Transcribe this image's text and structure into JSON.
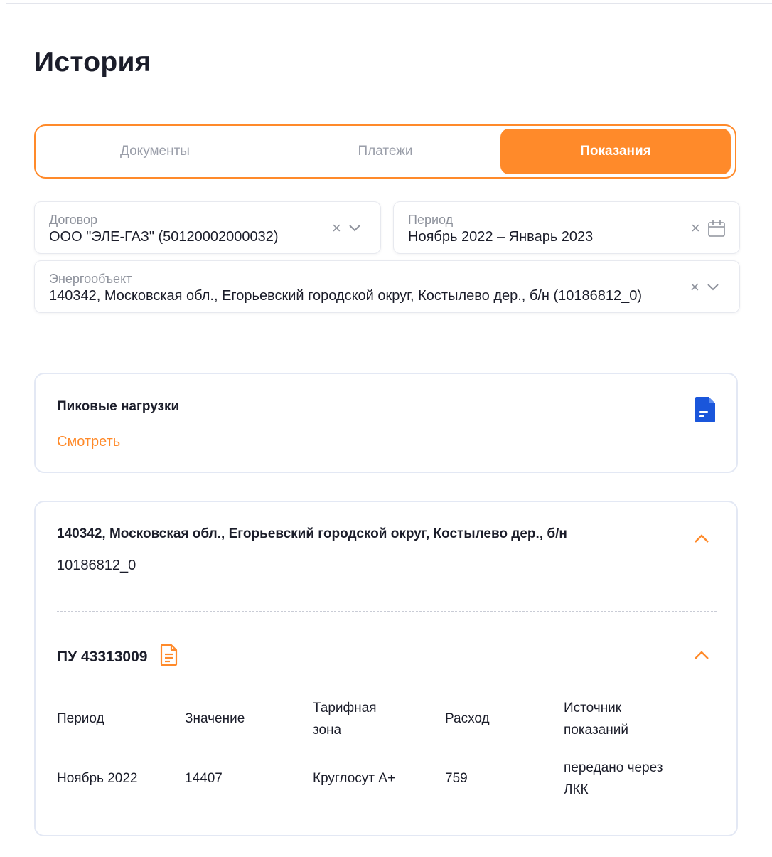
{
  "page_title": "История",
  "tabs": [
    {
      "label": "Документы",
      "active": false
    },
    {
      "label": "Платежи",
      "active": false
    },
    {
      "label": "Показания",
      "active": true
    }
  ],
  "filters": {
    "contract": {
      "label": "Договор",
      "value": "ООО \"ЭЛЕ-ГАЗ\" (50120002000032)"
    },
    "period": {
      "label": "Период",
      "value": "Ноябрь 2022 – Январь 2023"
    },
    "energy_object": {
      "label": "Энергообъект",
      "value": "140342, Московская обл., Егорьевский городской округ, Костылево дер., б/н (10186812_0)"
    }
  },
  "peak_card": {
    "title": "Пиковые нагрузки",
    "link": "Смотреть"
  },
  "object_card": {
    "address": "140342, Московская обл., Егорьевский городской округ, Костылево дер., б/н",
    "code": "10186812_0",
    "meter_title": "ПУ 43313009",
    "table": {
      "headers": [
        "Период",
        "Значение",
        "Тарифная зона",
        "Расход",
        "Источник показаний"
      ],
      "rows": [
        [
          "Ноябрь 2022",
          "14407",
          "Круглосут А+",
          "759",
          "передано через ЛКК"
        ]
      ]
    }
  },
  "colors": {
    "accent": "#ff8a2a",
    "doc_icon": "#1a56db"
  },
  "icons": {
    "clear": "×",
    "dropdown": "chevron-down-icon",
    "calendar": "calendar-icon",
    "collapse": "chevron-up-icon",
    "document": "document-icon"
  }
}
